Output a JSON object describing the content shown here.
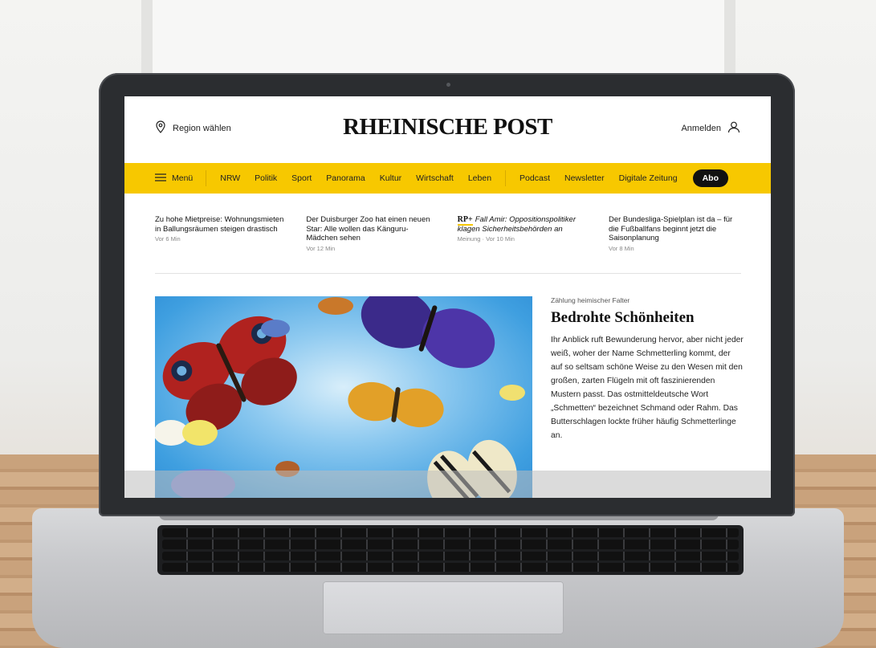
{
  "header": {
    "region_label": "Region wählen",
    "logo_text": "RHEINISCHE POST",
    "login_label": "Anmelden"
  },
  "nav": {
    "menu_label": "Menü",
    "items": [
      "NRW",
      "Politik",
      "Sport",
      "Panorama",
      "Kultur",
      "Wirtschaft",
      "Leben"
    ],
    "items_secondary": [
      "Podcast",
      "Newsletter",
      "Digitale Zeitung"
    ],
    "abo_label": "Abo",
    "background_color": "#f7c800"
  },
  "teasers": [
    {
      "title": "Zu hohe Mietpreise: Wohnungsmieten in Ballungsräumen steigen drastisch",
      "meta": "Vor 6 Min"
    },
    {
      "title": "Der Duisburger Zoo hat einen neuen Star: Alle wollen das Känguru-Mädchen sehen",
      "meta": "Vor 12 Min"
    },
    {
      "badge": "RP+",
      "title": "Fall Amir: Oppositionspolitiker klagen Sicherheitsbehörden an",
      "meta": "Meinung · Vor 10 Min"
    },
    {
      "title": "Der Bundesliga-Spielplan ist da – für die Fußballfans beginnt jetzt die Saisonplanung",
      "meta": "Vor 8 Min"
    }
  ],
  "hero": {
    "kicker": "Zählung heimischer Falter",
    "headline": "Bedrohte Schönheiten",
    "lead": "Ihr Anblick ruft Bewunderung hervor, aber nicht jeder weiß, woher der Name Schmetterling kommt, der auf so seltsam schöne Weise zu den Wesen mit den großen, zarten Flügeln mit oft faszinierenden Mustern passt. Das ostmitteldeutsche Wort „Schmetten“ bezeichnet Schmand oder Rahm. Das Butterschlagen lockte früher häufig Schmetterlinge an."
  }
}
